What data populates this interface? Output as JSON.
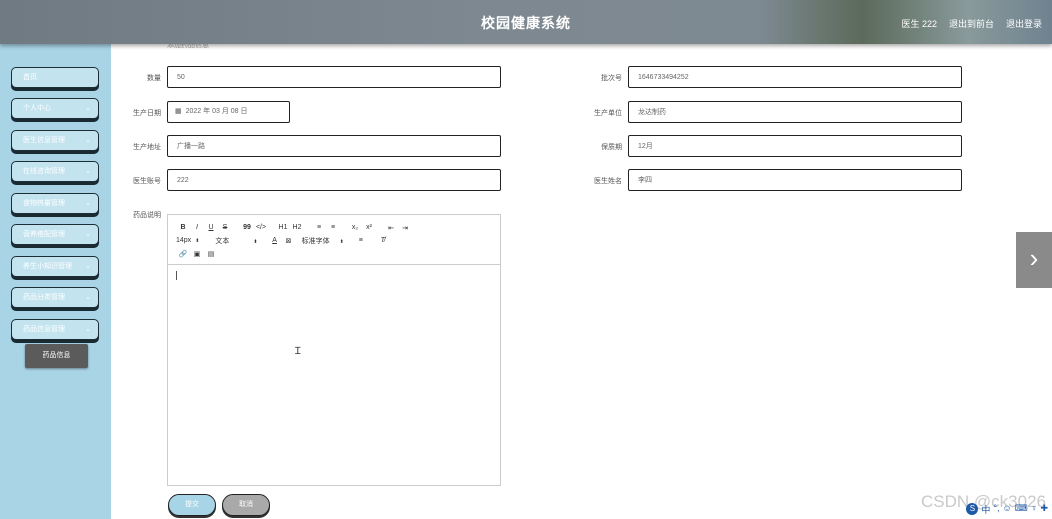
{
  "header": {
    "title": "校园健康系统",
    "user": "医生 222",
    "back_to_front": "退出到前台",
    "logout": "退出登录"
  },
  "sidebar": {
    "items": [
      {
        "label": "首页",
        "expandable": false
      },
      {
        "label": "个人中心",
        "expandable": true
      },
      {
        "label": "医生信息管理",
        "expandable": true
      },
      {
        "label": "在线咨询管理",
        "expandable": true
      },
      {
        "label": "食物热量管理",
        "expandable": true
      },
      {
        "label": "营养搭配管理",
        "expandable": true
      },
      {
        "label": "养生小知识管理",
        "expandable": true
      },
      {
        "label": "药品分类管理",
        "expandable": true
      },
      {
        "label": "药品信息管理",
        "expandable": true
      }
    ],
    "active_submenu": "药品信息"
  },
  "breadcrumb": "添加药品信息",
  "form": {
    "quantity": {
      "label": "数量",
      "value": "50"
    },
    "batch_no": {
      "label": "批次号",
      "value": "1646733494252"
    },
    "production_date": {
      "label": "生产日期",
      "value": "2022 年 03 月 08 日"
    },
    "manufacturer": {
      "label": "生产单位",
      "value": "龙达制药"
    },
    "production_address": {
      "label": "生产地址",
      "value": "广播一路"
    },
    "shelf_life": {
      "label": "保质期",
      "value": "12月"
    },
    "doctor_account": {
      "label": "医生账号",
      "value": "222"
    },
    "doctor_name": {
      "label": "医生姓名",
      "value": "李四"
    },
    "description": {
      "label": "药品说明",
      "value": ""
    }
  },
  "editor": {
    "row1": [
      "B",
      "I",
      "U",
      "S",
      "99",
      "</>",
      "H1",
      "H2",
      "≡",
      "≡",
      "x₂",
      "x²",
      "⇤",
      "⇥"
    ],
    "font_size": "14px",
    "text_type": "文本",
    "font_family": "标准字体",
    "row3": [
      "🔗",
      "▣",
      "▤"
    ]
  },
  "buttons": {
    "submit": "提交",
    "cancel": "取消"
  },
  "watermark": "CSDN @ck3026",
  "ime": [
    "S",
    "中",
    "°,",
    "☺",
    "⌨",
    "♀",
    "✚"
  ]
}
